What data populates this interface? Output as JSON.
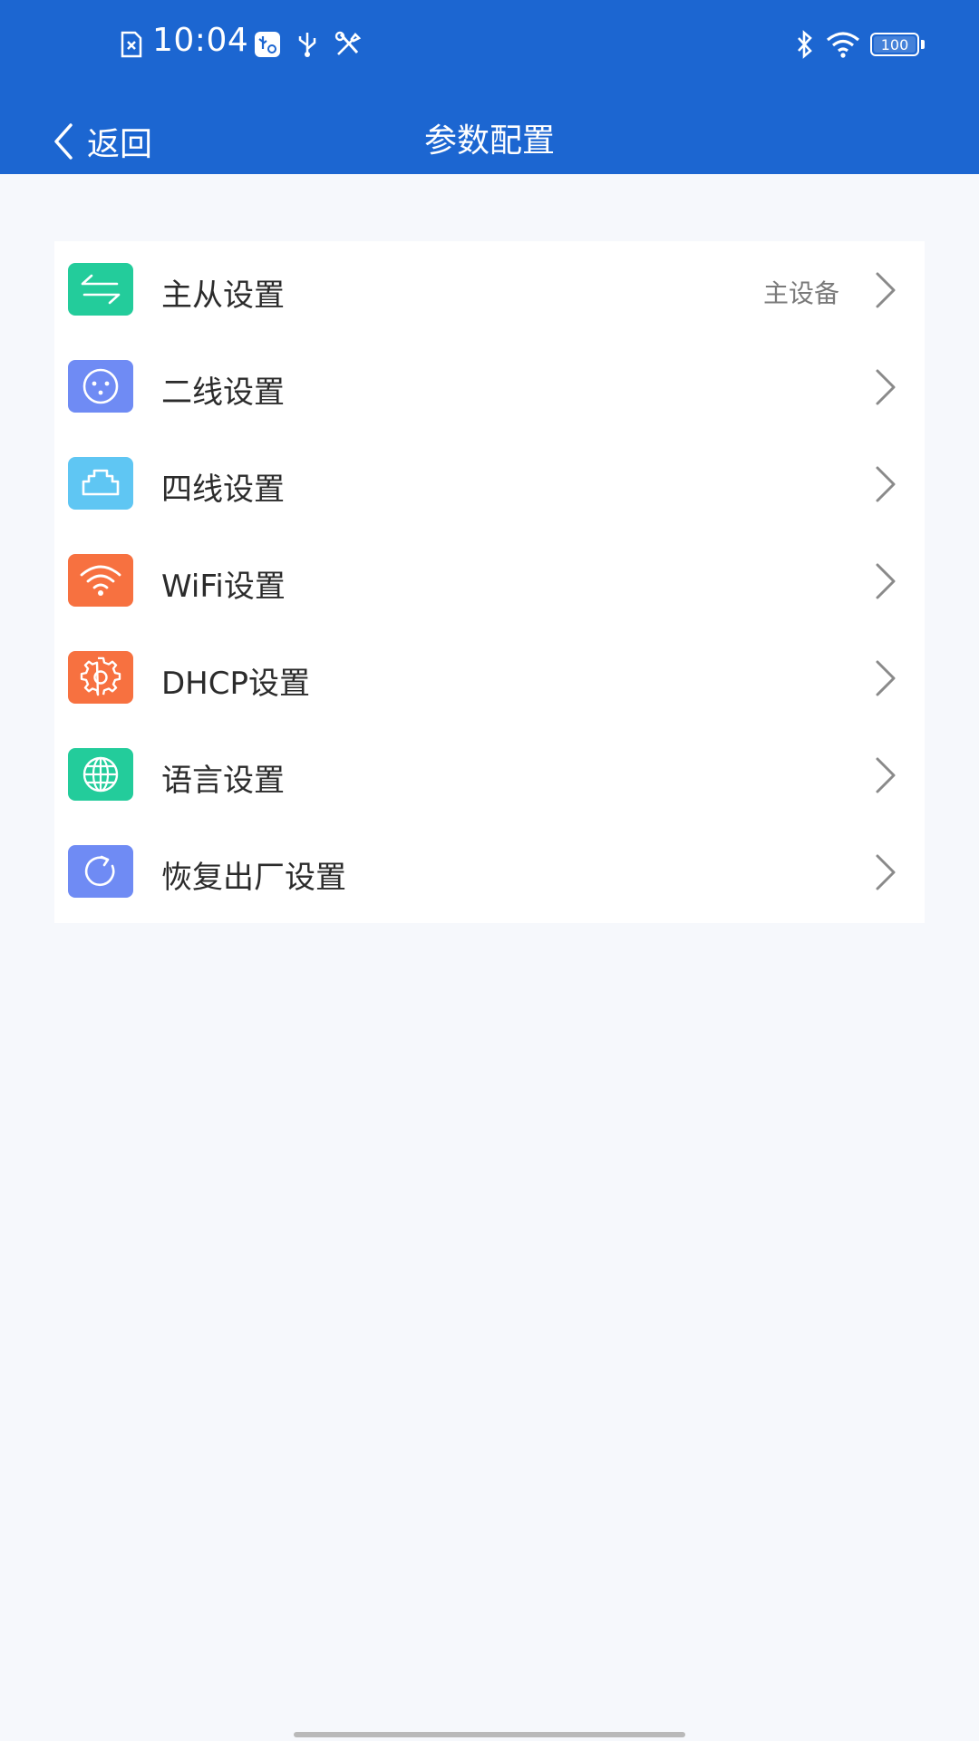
{
  "status_bar": {
    "time": "10:04",
    "battery_level": "100",
    "icons": [
      "sim-alert-icon",
      "usb-debug-icon",
      "usb-icon",
      "tools-icon",
      "bluetooth-icon",
      "wifi-icon",
      "battery-icon"
    ]
  },
  "header": {
    "back_label": "返回",
    "title": "参数配置",
    "background_color": "#1c66d1"
  },
  "settings": {
    "items": [
      {
        "label": "主从设置",
        "value": "主设备",
        "icon": "swap-arrows-icon",
        "icon_color": "#23cc9b"
      },
      {
        "label": "二线设置",
        "value": "",
        "icon": "two-wire-socket-icon",
        "icon_color": "#6f8bf4"
      },
      {
        "label": "四线设置",
        "value": "",
        "icon": "ethernet-port-icon",
        "icon_color": "#5fc6f3"
      },
      {
        "label": "WiFi设置",
        "value": "",
        "icon": "wifi-icon",
        "icon_color": "#f77140"
      },
      {
        "label": "DHCP设置",
        "value": "",
        "icon": "gear-icon",
        "icon_color": "#f77140"
      },
      {
        "label": "语言设置",
        "value": "",
        "icon": "globe-icon",
        "icon_color": "#23cc9b"
      },
      {
        "label": "恢复出厂设置",
        "value": "",
        "icon": "reset-icon",
        "icon_color": "#6f8bf4"
      }
    ]
  }
}
